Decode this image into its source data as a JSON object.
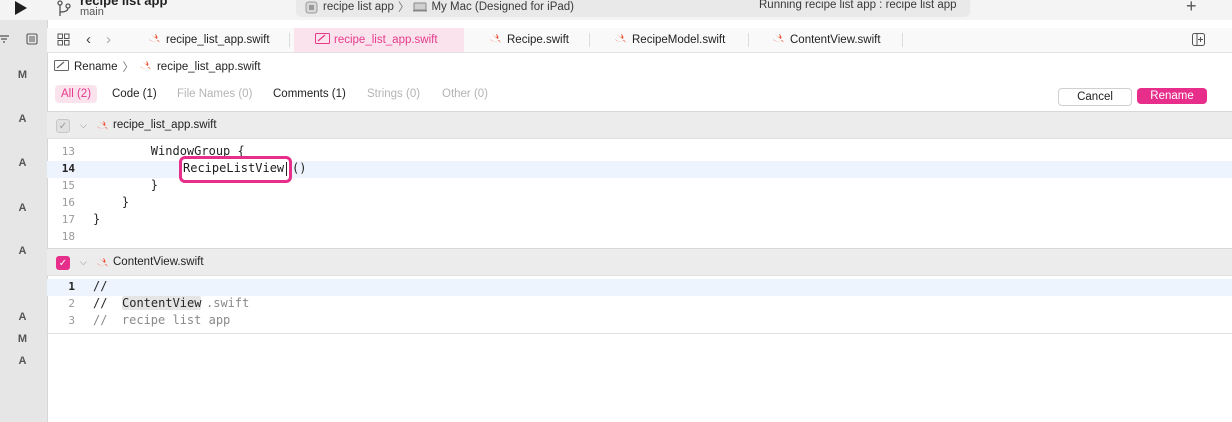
{
  "window": {
    "project": "recipe list app",
    "branch": "main",
    "scheme": "recipe list app",
    "destination": "My Mac (Designed for iPad)",
    "status": "Running recipe list app : recipe list app"
  },
  "tabs": [
    {
      "label": "recipe_list_app.swift"
    },
    {
      "label": "recipe_list_app.swift"
    },
    {
      "label": "Recipe.swift"
    },
    {
      "label": "RecipeModel.swift"
    },
    {
      "label": "ContentView.swift"
    }
  ],
  "breadcrumb": {
    "first": "Rename",
    "second": "recipe_list_app.swift"
  },
  "filters": [
    "All (2)",
    "Code (1)",
    "File Names (0)",
    "Comments (1)",
    "Strings (0)",
    "Other (0)"
  ],
  "buttons": {
    "cancel": "Cancel",
    "rename": "Rename"
  },
  "gutter": [
    "M",
    "A",
    "A",
    "A",
    "A",
    "A",
    "M",
    "A"
  ],
  "files": [
    {
      "name": "recipe_list_app.swift",
      "checked": false,
      "lines": [
        {
          "num": "13",
          "text": "        WindowGroup {"
        },
        {
          "num": "14",
          "pre": "            ",
          "token": "RecipeListView",
          "post": "()"
        },
        {
          "num": "15",
          "text": "        }"
        },
        {
          "num": "16",
          "text": "    }"
        },
        {
          "num": "17",
          "text": "}"
        },
        {
          "num": "18",
          "text": ""
        }
      ]
    },
    {
      "name": "ContentView.swift",
      "checked": true,
      "lines": [
        {
          "num": "1",
          "text": "//"
        },
        {
          "num": "2",
          "pre": "//  ",
          "token": "ContentView",
          "post": ".swift"
        },
        {
          "num": "3",
          "text": "//  recipe list app"
        }
      ]
    }
  ],
  "colors": {
    "accent": "#e62e8a",
    "accent_bg": "#fbe3ee",
    "swift_orange": "#f05138"
  }
}
